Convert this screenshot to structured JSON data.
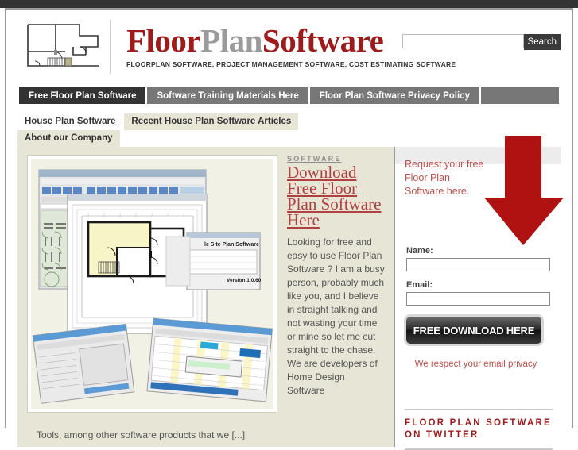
{
  "brand": {
    "title_part1": "Floor",
    "title_part2": "Plan",
    "title_part3": "Software",
    "tagline": "FLOORPLAN SOFTWARE, PROJECT MANAGEMENT SOFTWARE, COST ESTIMATING SOFTWARE",
    "logo_alt": "floor-plan-line-drawing"
  },
  "search": {
    "value": "",
    "placeholder": "",
    "button_label": "Search"
  },
  "nav": {
    "items": [
      {
        "label": "Free Floor Plan Software",
        "active": true
      },
      {
        "label": "Software Training Materials Here",
        "active": false
      },
      {
        "label": "Floor Plan Software Privacy Policy",
        "active": false
      }
    ]
  },
  "tabs": {
    "row1": [
      {
        "label": "House Plan Software",
        "active": true
      },
      {
        "label": "Recent House Plan Software Articles",
        "active": false
      }
    ],
    "row2": [
      {
        "label": "About our Company",
        "active": false
      }
    ]
  },
  "article": {
    "kicker": "SOFTWARE",
    "headline": "Download Free Floor Plan Software Here",
    "body": "Looking for free and easy to use Floor Plan Software ? I am a busy person, probably much like you, and I believe in straight talking and not wasting your time or mine so let me cut straight to the chase. We are developers of Home Design Software",
    "tail": "Tools, among other software products that we [...]",
    "image_alt": "floor-plan-software-screenshot-collage"
  },
  "sidebar": {
    "lead": "Request your free Floor Plan Software here.",
    "arrow_alt": "red-down-arrow",
    "name_label": "Name:",
    "name_value": "",
    "email_label": "Email:",
    "email_value": "",
    "download_button": "FREE DOWNLOAD HERE",
    "privacy": "We respect your email privacy",
    "twitter_title": "FLOOR PLAN SOFTWARE ON TWITTER"
  },
  "colors": {
    "brand_red": "#9e1b1b",
    "link_red": "#b04040",
    "accent_red": "#c0504d",
    "nav_bg": "#777777",
    "nav_active": "#333333",
    "content_bg": "#e7e5d6",
    "topbar": "#333333"
  }
}
